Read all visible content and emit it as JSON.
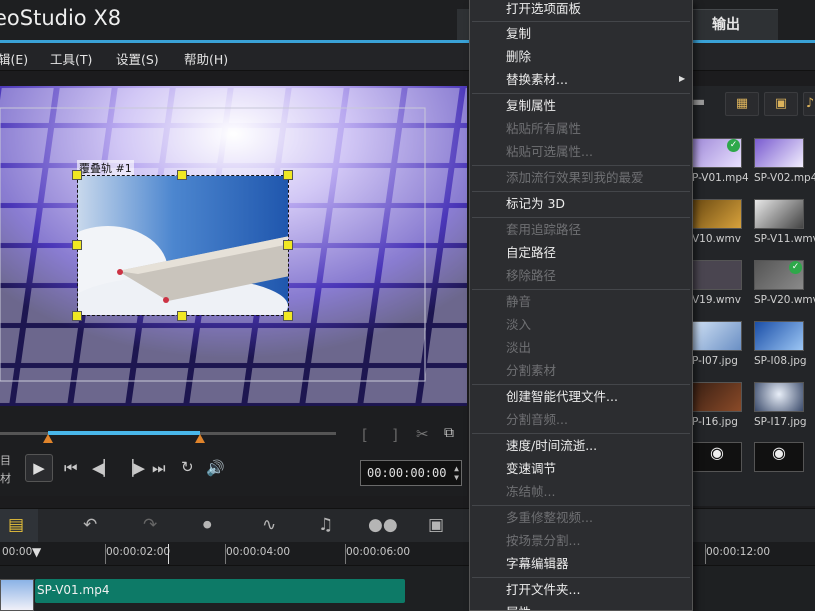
{
  "window": {
    "title": "eoStudio X8"
  },
  "tabs": {
    "output": "输出"
  },
  "menubar": {
    "items": [
      "辑(E)",
      "工具(T)",
      "设置(S)",
      "帮助(H)"
    ]
  },
  "preview": {
    "overlay_label": "覆叠轨 #1"
  },
  "player": {
    "timecode": "00:00:00:00",
    "side_labels": [
      "目",
      "材"
    ],
    "controls": [
      "play-icon",
      "skip-start-icon",
      "step-back-icon",
      "step-forward-icon",
      "skip-end-icon",
      "repeat-icon",
      "volume-icon"
    ],
    "trim_controls": [
      "[",
      "]"
    ]
  },
  "library": {
    "thumbnails": [
      {
        "label": "P-V01.mp4",
        "checked": true
      },
      {
        "label": "SP-V02.mp4",
        "checked": false
      },
      {
        "label": "V10.wmv",
        "checked": false
      },
      {
        "label": "SP-V11.wmv",
        "checked": false
      },
      {
        "label": "V19.wmv",
        "checked": false
      },
      {
        "label": "SP-V20.wmv",
        "checked": true
      },
      {
        "label": "P-I07.jpg",
        "checked": false
      },
      {
        "label": "SP-I08.jpg",
        "checked": false
      },
      {
        "label": "P-I16.jpg",
        "checked": false
      },
      {
        "label": "SP-I17.jpg",
        "checked": false
      }
    ]
  },
  "timeline": {
    "ruler_labels": [
      "00:00",
      "00:00:02:00",
      "00:00:04:00",
      "00:00:06:00",
      "00:00:12:00"
    ],
    "clip_label": "SP-V01.mp4"
  },
  "context_menu": {
    "items": [
      {
        "label": "打开选项面板",
        "enabled": true
      },
      {
        "label": "复制",
        "enabled": true
      },
      {
        "label": "删除",
        "enabled": true
      },
      {
        "label": "替换素材...",
        "enabled": true,
        "submenu": true
      },
      {
        "label": "复制属性",
        "enabled": true
      },
      {
        "label": "粘贴所有属性",
        "enabled": false
      },
      {
        "label": "粘贴可选属性...",
        "enabled": false
      },
      {
        "label": "添加流行效果到我的最爱",
        "enabled": false
      },
      {
        "label": "标记为 3D",
        "enabled": true
      },
      {
        "label": "套用追踪路径",
        "enabled": false
      },
      {
        "label": "自定路径",
        "enabled": true
      },
      {
        "label": "移除路径",
        "enabled": false
      },
      {
        "label": "静音",
        "enabled": false
      },
      {
        "label": "淡入",
        "enabled": false
      },
      {
        "label": "淡出",
        "enabled": false
      },
      {
        "label": "分割素材",
        "enabled": false
      },
      {
        "label": "创建智能代理文件...",
        "enabled": true
      },
      {
        "label": "分割音频...",
        "enabled": false
      },
      {
        "label": "速度/时间流逝...",
        "enabled": true
      },
      {
        "label": "变速调节",
        "enabled": true
      },
      {
        "label": "冻结帧...",
        "enabled": false
      },
      {
        "label": "多重修整视频...",
        "enabled": false
      },
      {
        "label": "按场景分割...",
        "enabled": false
      },
      {
        "label": "字幕编辑器",
        "enabled": true
      },
      {
        "label": "打开文件夹...",
        "enabled": true
      },
      {
        "label": "属性",
        "enabled": true
      }
    ]
  },
  "colors": {
    "accent": "#3aa2d7",
    "clip": "#0d7a67",
    "handle": "#f0e822",
    "trim_marker": "#e0842b"
  }
}
